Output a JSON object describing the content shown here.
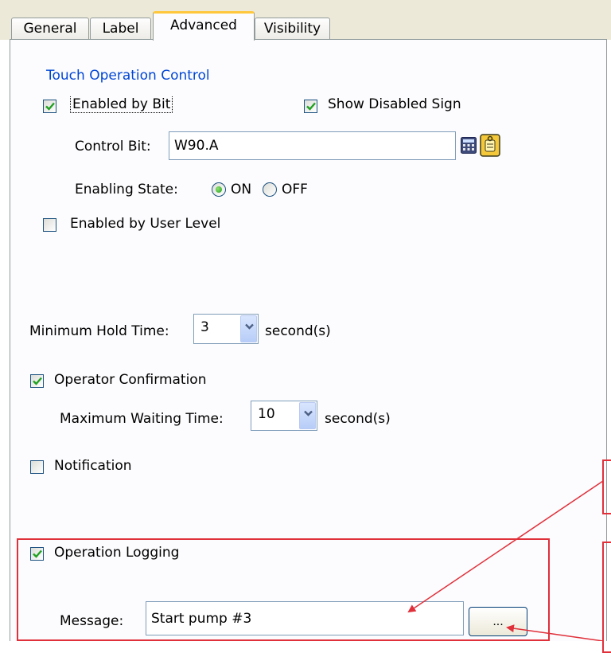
{
  "tabs": [
    "General",
    "Label",
    "Advanced",
    "Visibility"
  ],
  "active_tab": "Advanced",
  "touch_group": {
    "legend": "Touch Operation Control",
    "enabled_by_bit": {
      "label": "Enabled by Bit",
      "checked": true
    },
    "show_disabled_sign": {
      "label": "Show Disabled Sign",
      "checked": true
    },
    "control_bit": {
      "label": "Control Bit:",
      "value": "W90.A",
      "icons": [
        "address-calculator-icon",
        "tag-browse-icon"
      ]
    },
    "enabling_state": {
      "label": "Enabling State:",
      "options": [
        "ON",
        "OFF"
      ],
      "selected": "ON"
    },
    "enabled_by_user_level": {
      "label": "Enabled by User Level",
      "checked": false
    }
  },
  "min_hold_time": {
    "label": "Minimum Hold Time:",
    "value": "3",
    "unit": "second(s)"
  },
  "operator_confirmation": {
    "label": "Operator Confirmation",
    "checked": true,
    "max_wait": {
      "label": "Maximum Waiting Time:",
      "value": "10",
      "unit": "second(s)"
    }
  },
  "notification": {
    "label": "Notification",
    "checked": false
  },
  "operation_logging": {
    "label": "Operation Logging",
    "checked": true,
    "message": {
      "label": "Message:",
      "value": "Start pump #3"
    },
    "browse_label": "..."
  },
  "colors": {
    "accent_tab": "#ffc83c",
    "group_legend": "#0046d5",
    "check": "#21a121",
    "annotation": "#e0303a"
  }
}
